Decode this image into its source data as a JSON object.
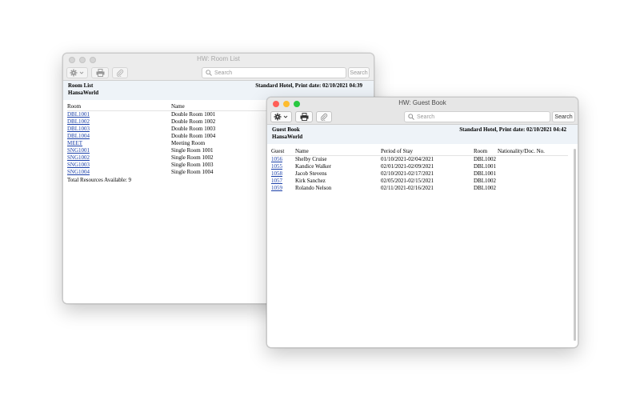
{
  "room_window": {
    "title": "HW: Room List",
    "search_placeholder": "Search",
    "search_button": "Search",
    "report_title": "Room List",
    "report_org": "HansaWorld",
    "report_info": "Standard Hotel, Print date: 02/10/2021 04:39",
    "columns": [
      "Room",
      "Name"
    ],
    "rows": [
      {
        "room": "DBL1001",
        "name": "Double Room 1001"
      },
      {
        "room": "DBL1002",
        "name": "Double Room 1002"
      },
      {
        "room": "DBL1003",
        "name": "Double Room 1003"
      },
      {
        "room": "DBL1004",
        "name": "Double Room 1004"
      },
      {
        "room": "MEET",
        "name": "Meeting Room"
      },
      {
        "room": "SNG1001",
        "name": "Single Room 1001"
      },
      {
        "room": "SNG1002",
        "name": "Single Room 1002"
      },
      {
        "room": "SNG1003",
        "name": "Single Room 1003"
      },
      {
        "room": "SNG1004",
        "name": "Single Room 1004"
      }
    ],
    "total": "Total Resources Available: 9"
  },
  "guest_window": {
    "title": "HW: Guest Book",
    "search_placeholder": "Search",
    "search_button": "Search",
    "report_title": "Guest Book",
    "report_org": "HansaWorld",
    "report_info": "Standard Hotel, Print date: 02/10/2021 04:42",
    "columns": [
      "Guest",
      "Name",
      "Period of Stay",
      "Room",
      "Nationality/Doc. No."
    ],
    "rows": [
      {
        "guest": "1056",
        "name": "Shelby Cruise",
        "period": "01/10/2021-02/04/2021",
        "room": "DBL1002"
      },
      {
        "guest": "1055",
        "name": "Kandice Walker",
        "period": "02/01/2021-02/09/2021",
        "room": "DBL1001"
      },
      {
        "guest": "1058",
        "name": "Jacob Stevens",
        "period": "02/10/2021-02/17/2021",
        "room": "DBL1001"
      },
      {
        "guest": "1057",
        "name": "Kirk Sanchez",
        "period": "02/05/2021-02/15/2021",
        "room": "DBL1002"
      },
      {
        "guest": "1059",
        "name": "Rolando Nelson",
        "period": "02/11/2021-02/16/2021",
        "room": "DBL1002"
      }
    ]
  },
  "icons": {
    "gear": "gear-icon",
    "chevron": "chevron-down-icon",
    "print": "printer-icon",
    "attach": "paperclip-icon",
    "search": "search-icon"
  },
  "colors": {
    "link": "#1a3fa8",
    "report_header_bg": "#eef3f8",
    "close": "#ff5f57",
    "minimize": "#febc2e",
    "maximize": "#28c840"
  }
}
